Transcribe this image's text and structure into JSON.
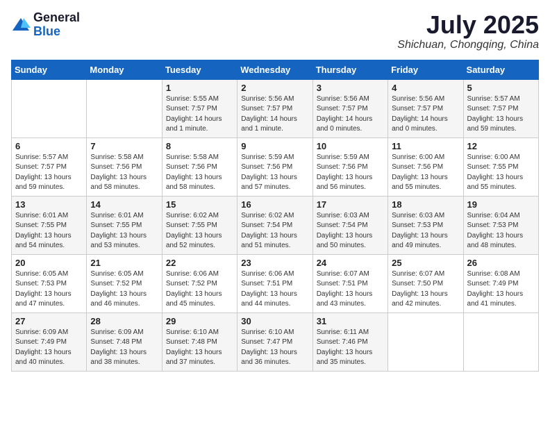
{
  "header": {
    "logo_general": "General",
    "logo_blue": "Blue",
    "month": "July 2025",
    "location": "Shichuan, Chongqing, China"
  },
  "weekdays": [
    "Sunday",
    "Monday",
    "Tuesday",
    "Wednesday",
    "Thursday",
    "Friday",
    "Saturday"
  ],
  "weeks": [
    [
      {
        "day": "",
        "info": ""
      },
      {
        "day": "",
        "info": ""
      },
      {
        "day": "1",
        "info": "Sunrise: 5:55 AM\nSunset: 7:57 PM\nDaylight: 14 hours and 1 minute."
      },
      {
        "day": "2",
        "info": "Sunrise: 5:56 AM\nSunset: 7:57 PM\nDaylight: 14 hours and 1 minute."
      },
      {
        "day": "3",
        "info": "Sunrise: 5:56 AM\nSunset: 7:57 PM\nDaylight: 14 hours and 0 minutes."
      },
      {
        "day": "4",
        "info": "Sunrise: 5:56 AM\nSunset: 7:57 PM\nDaylight: 14 hours and 0 minutes."
      },
      {
        "day": "5",
        "info": "Sunrise: 5:57 AM\nSunset: 7:57 PM\nDaylight: 13 hours and 59 minutes."
      }
    ],
    [
      {
        "day": "6",
        "info": "Sunrise: 5:57 AM\nSunset: 7:57 PM\nDaylight: 13 hours and 59 minutes."
      },
      {
        "day": "7",
        "info": "Sunrise: 5:58 AM\nSunset: 7:56 PM\nDaylight: 13 hours and 58 minutes."
      },
      {
        "day": "8",
        "info": "Sunrise: 5:58 AM\nSunset: 7:56 PM\nDaylight: 13 hours and 58 minutes."
      },
      {
        "day": "9",
        "info": "Sunrise: 5:59 AM\nSunset: 7:56 PM\nDaylight: 13 hours and 57 minutes."
      },
      {
        "day": "10",
        "info": "Sunrise: 5:59 AM\nSunset: 7:56 PM\nDaylight: 13 hours and 56 minutes."
      },
      {
        "day": "11",
        "info": "Sunrise: 6:00 AM\nSunset: 7:56 PM\nDaylight: 13 hours and 55 minutes."
      },
      {
        "day": "12",
        "info": "Sunrise: 6:00 AM\nSunset: 7:55 PM\nDaylight: 13 hours and 55 minutes."
      }
    ],
    [
      {
        "day": "13",
        "info": "Sunrise: 6:01 AM\nSunset: 7:55 PM\nDaylight: 13 hours and 54 minutes."
      },
      {
        "day": "14",
        "info": "Sunrise: 6:01 AM\nSunset: 7:55 PM\nDaylight: 13 hours and 53 minutes."
      },
      {
        "day": "15",
        "info": "Sunrise: 6:02 AM\nSunset: 7:55 PM\nDaylight: 13 hours and 52 minutes."
      },
      {
        "day": "16",
        "info": "Sunrise: 6:02 AM\nSunset: 7:54 PM\nDaylight: 13 hours and 51 minutes."
      },
      {
        "day": "17",
        "info": "Sunrise: 6:03 AM\nSunset: 7:54 PM\nDaylight: 13 hours and 50 minutes."
      },
      {
        "day": "18",
        "info": "Sunrise: 6:03 AM\nSunset: 7:53 PM\nDaylight: 13 hours and 49 minutes."
      },
      {
        "day": "19",
        "info": "Sunrise: 6:04 AM\nSunset: 7:53 PM\nDaylight: 13 hours and 48 minutes."
      }
    ],
    [
      {
        "day": "20",
        "info": "Sunrise: 6:05 AM\nSunset: 7:53 PM\nDaylight: 13 hours and 47 minutes."
      },
      {
        "day": "21",
        "info": "Sunrise: 6:05 AM\nSunset: 7:52 PM\nDaylight: 13 hours and 46 minutes."
      },
      {
        "day": "22",
        "info": "Sunrise: 6:06 AM\nSunset: 7:52 PM\nDaylight: 13 hours and 45 minutes."
      },
      {
        "day": "23",
        "info": "Sunrise: 6:06 AM\nSunset: 7:51 PM\nDaylight: 13 hours and 44 minutes."
      },
      {
        "day": "24",
        "info": "Sunrise: 6:07 AM\nSunset: 7:51 PM\nDaylight: 13 hours and 43 minutes."
      },
      {
        "day": "25",
        "info": "Sunrise: 6:07 AM\nSunset: 7:50 PM\nDaylight: 13 hours and 42 minutes."
      },
      {
        "day": "26",
        "info": "Sunrise: 6:08 AM\nSunset: 7:49 PM\nDaylight: 13 hours and 41 minutes."
      }
    ],
    [
      {
        "day": "27",
        "info": "Sunrise: 6:09 AM\nSunset: 7:49 PM\nDaylight: 13 hours and 40 minutes."
      },
      {
        "day": "28",
        "info": "Sunrise: 6:09 AM\nSunset: 7:48 PM\nDaylight: 13 hours and 38 minutes."
      },
      {
        "day": "29",
        "info": "Sunrise: 6:10 AM\nSunset: 7:48 PM\nDaylight: 13 hours and 37 minutes."
      },
      {
        "day": "30",
        "info": "Sunrise: 6:10 AM\nSunset: 7:47 PM\nDaylight: 13 hours and 36 minutes."
      },
      {
        "day": "31",
        "info": "Sunrise: 6:11 AM\nSunset: 7:46 PM\nDaylight: 13 hours and 35 minutes."
      },
      {
        "day": "",
        "info": ""
      },
      {
        "day": "",
        "info": ""
      }
    ]
  ]
}
